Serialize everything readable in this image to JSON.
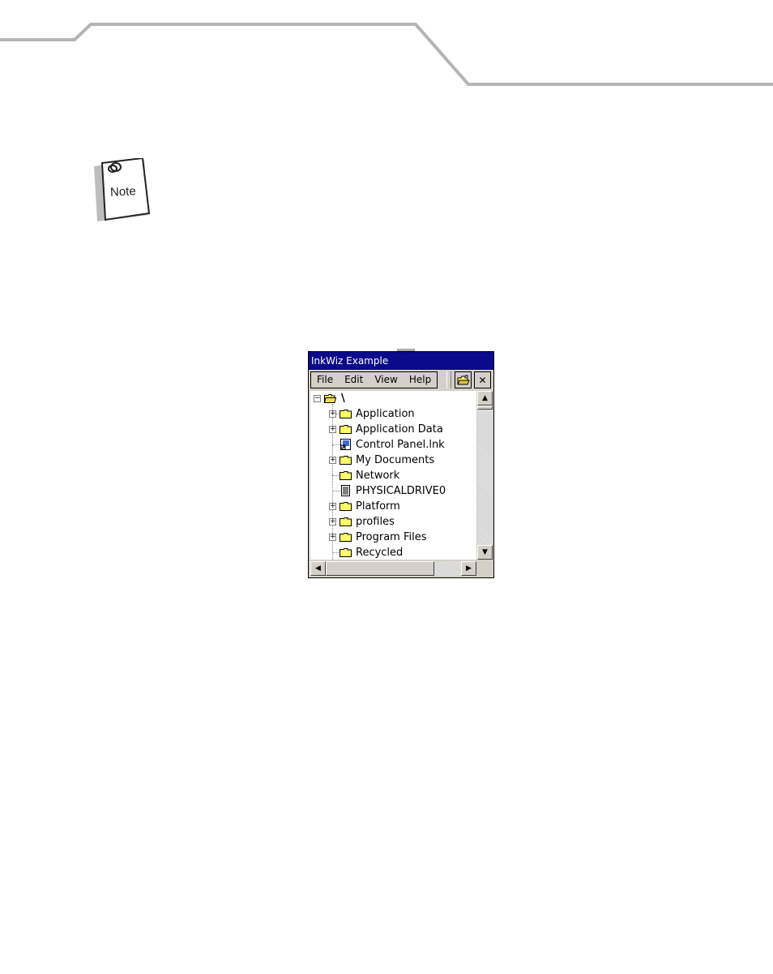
{
  "note": {
    "label": "Note"
  },
  "window": {
    "title": "InkWiz Example",
    "menu": [
      "File",
      "Edit",
      "View",
      "Help"
    ],
    "close_glyph": "✕"
  },
  "tree": {
    "root_label": "\\",
    "items": [
      {
        "label": "Application",
        "expander": "+",
        "icon": "folder-icon"
      },
      {
        "label": "Application Data",
        "expander": "+",
        "icon": "folder-icon"
      },
      {
        "label": "Control Panel.lnk",
        "expander": "",
        "icon": "shortcut-icon"
      },
      {
        "label": "My Documents",
        "expander": "+",
        "icon": "folder-icon"
      },
      {
        "label": "Network",
        "expander": "",
        "icon": "folder-icon"
      },
      {
        "label": "PHYSICALDRIVE0",
        "expander": "",
        "icon": "file-icon"
      },
      {
        "label": "Platform",
        "expander": "+",
        "icon": "folder-icon"
      },
      {
        "label": "profiles",
        "expander": "+",
        "icon": "folder-icon"
      },
      {
        "label": "Program Files",
        "expander": "+",
        "icon": "folder-icon"
      },
      {
        "label": "Recycled",
        "expander": "",
        "icon": "folder-icon"
      }
    ]
  },
  "colors": {
    "titlebar": "#0a0a8a",
    "folder": "#ffff66"
  }
}
